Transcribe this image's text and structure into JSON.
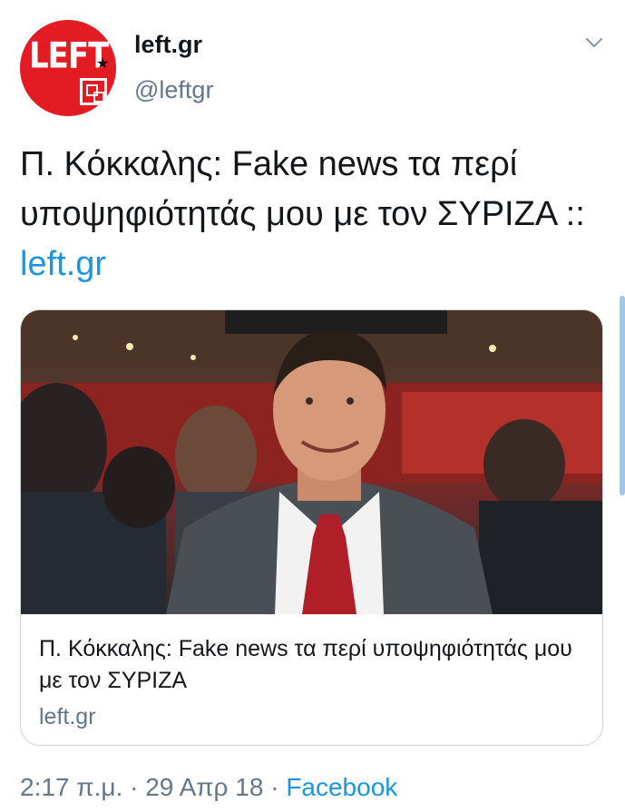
{
  "account": {
    "display_name": "left.gr",
    "handle": "@leftgr",
    "avatar_logo_text": "LEFT",
    "avatar_icon": "left-gr-logo"
  },
  "tweet": {
    "text_main": "Π. Κόκκαλης: Fake news τα περί υποψηφιότητάς μου με τον ΣΥΡΙΖΑ :: ",
    "text_link": "left.gr"
  },
  "card": {
    "image_icon": "photo-man-in-suit",
    "title": "Π. Κόκκαλης: Fake news τα περί υποψηφιότητάς μου με τον ΣΥΡΙΖΑ",
    "domain": "left.gr"
  },
  "meta": {
    "time": "2:17 π.μ.",
    "separator1": " · ",
    "date": "29 Απρ 18",
    "separator2": " · ",
    "source": "Facebook"
  },
  "icons": {
    "menu": "chevron-down-icon"
  },
  "colors": {
    "link": "#1b95e0",
    "secondary_text": "#657786",
    "avatar_red": "#e31b23"
  }
}
